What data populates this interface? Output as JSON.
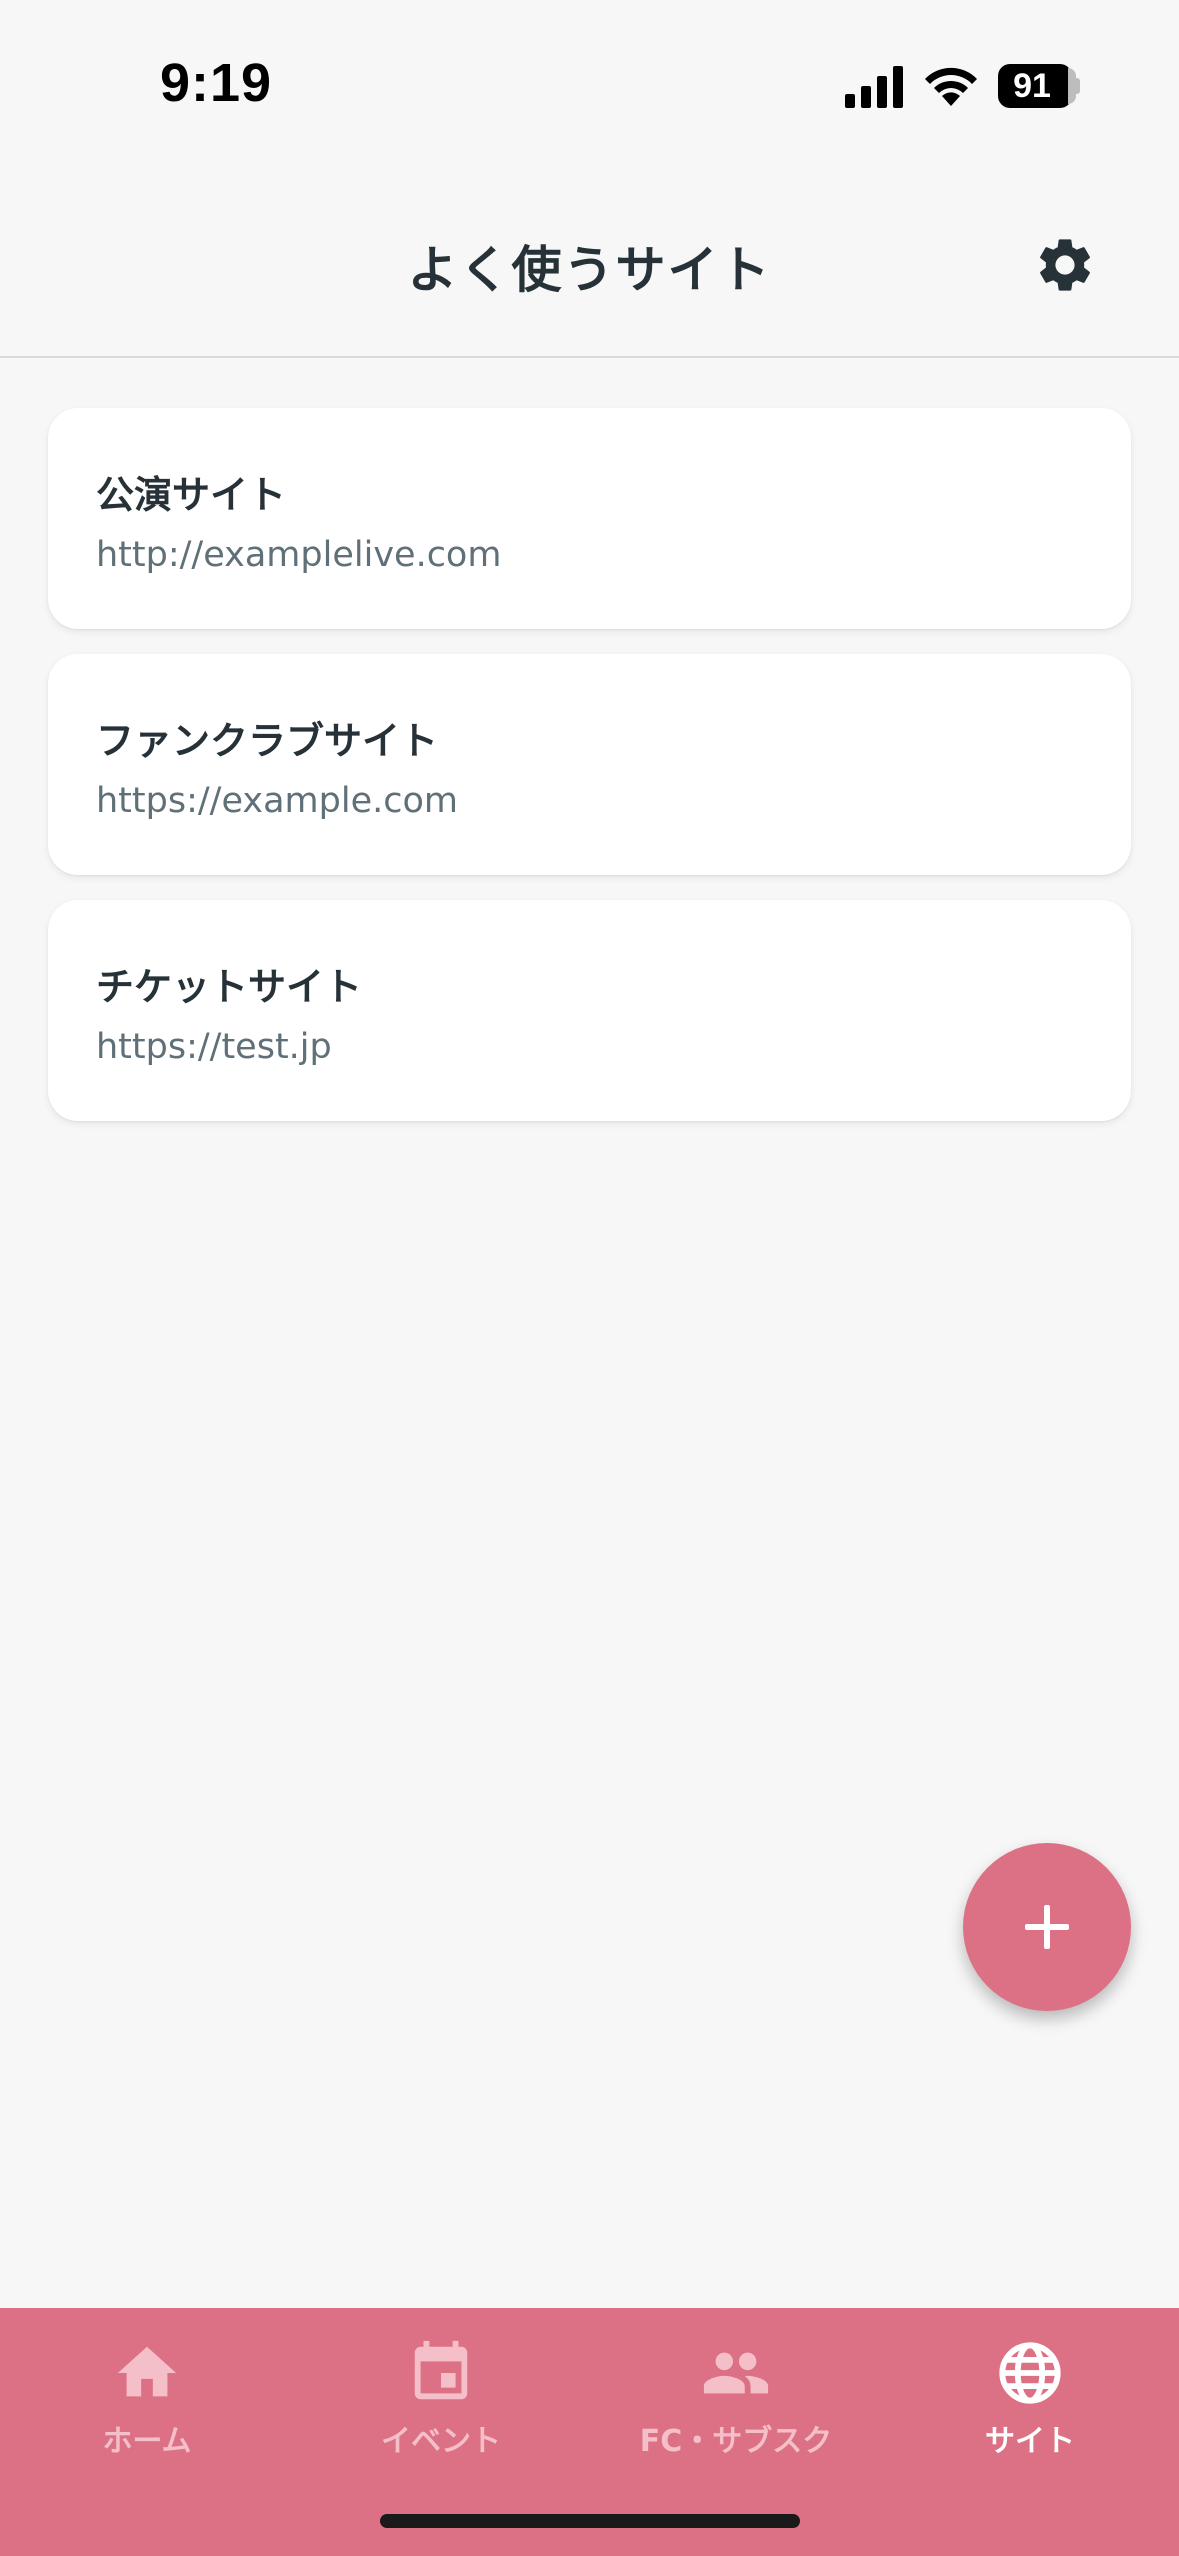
{
  "status_bar": {
    "time": "9:19",
    "battery_level": "91"
  },
  "header": {
    "title": "よく使うサイト",
    "settings_icon": "gear-icon"
  },
  "sites": [
    {
      "name": "公演サイト",
      "url": "http://examplelive.com"
    },
    {
      "name": "ファンクラブサイト",
      "url": "https://example.com"
    },
    {
      "name": "チケットサイト",
      "url": "https://test.jp"
    }
  ],
  "fab": {
    "icon": "plus-icon"
  },
  "bottom_nav": {
    "items": [
      {
        "label": "ホーム",
        "icon": "home-icon",
        "active": false
      },
      {
        "label": "イベント",
        "icon": "calendar-icon",
        "active": false
      },
      {
        "label": "FC・サブスク",
        "icon": "people-icon",
        "active": false
      },
      {
        "label": "サイト",
        "icon": "globe-icon",
        "active": true
      }
    ]
  },
  "colors": {
    "accent": "#dc7185",
    "nav_inactive": "#f5bfc9",
    "text_primary": "#263238",
    "text_secondary": "#607078",
    "background": "#f7f7f7"
  }
}
